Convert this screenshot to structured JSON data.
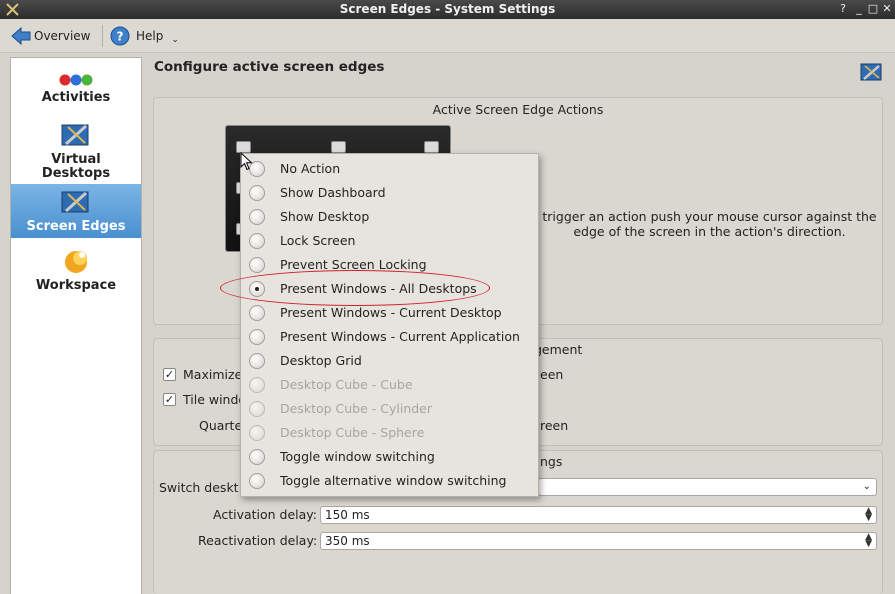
{
  "window": {
    "title": "Screen Edges - System Settings"
  },
  "toolbar": {
    "overview_label": "Overview",
    "help_label": "Help"
  },
  "sidebar": {
    "items": [
      {
        "label": "Activities"
      },
      {
        "label": "Virtual Desktops"
      },
      {
        "label": "Screen Edges"
      },
      {
        "label": "Workspace"
      }
    ]
  },
  "main": {
    "title": "Configure active screen edges",
    "actions_group_title": "Active Screen Edge Actions",
    "help_text": "trigger an action push your mouse cursor against the edge of the screen in the action's direction.",
    "window_mgmt_title": "gement",
    "maximize_label": "Maximize",
    "maximize_suffix": "een",
    "tile_label": "Tile windo",
    "quarter_label": "Quarte",
    "quarter_suffix": "reen",
    "other_title": "ngs",
    "switch_label": "Switch deskt",
    "activation_delay_label": "Activation delay:",
    "activation_delay_value": "150 ms",
    "reactivation_delay_label": "Reactivation delay:",
    "reactivation_delay_value": "350 ms"
  },
  "popup": {
    "options": [
      {
        "label": "No Action",
        "enabled": true,
        "selected": false
      },
      {
        "label": "Show Dashboard",
        "enabled": true,
        "selected": false
      },
      {
        "label": "Show Desktop",
        "enabled": true,
        "selected": false
      },
      {
        "label": "Lock Screen",
        "enabled": true,
        "selected": false
      },
      {
        "label": "Prevent Screen Locking",
        "enabled": true,
        "selected": false
      },
      {
        "label": "Present Windows - All Desktops",
        "enabled": true,
        "selected": true
      },
      {
        "label": "Present Windows - Current Desktop",
        "enabled": true,
        "selected": false
      },
      {
        "label": "Present Windows - Current Application",
        "enabled": true,
        "selected": false
      },
      {
        "label": "Desktop Grid",
        "enabled": true,
        "selected": false
      },
      {
        "label": "Desktop Cube - Cube",
        "enabled": false,
        "selected": false
      },
      {
        "label": "Desktop Cube - Cylinder",
        "enabled": false,
        "selected": false
      },
      {
        "label": "Desktop Cube - Sphere",
        "enabled": false,
        "selected": false
      },
      {
        "label": "Toggle window switching",
        "enabled": true,
        "selected": false
      },
      {
        "label": "Toggle alternative window switching",
        "enabled": true,
        "selected": false
      }
    ]
  },
  "colors": {
    "highlight_ellipse": "#d0202a",
    "selection": "#4a8fd0"
  }
}
